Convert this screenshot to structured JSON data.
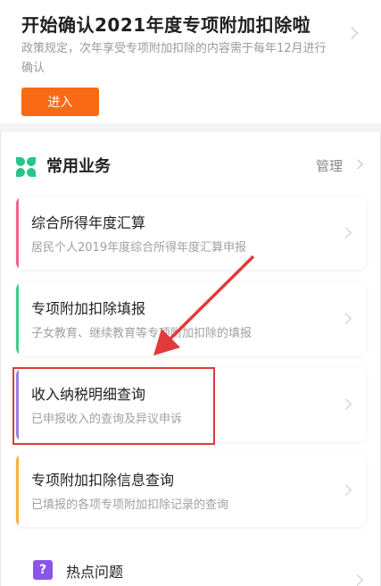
{
  "notice": {
    "title": "开始确认2021年度专项附加扣除啦",
    "description": "政策规定，次年享受专项附加扣除的内容需于每年12月进行确认",
    "enter_label": "进入"
  },
  "section": {
    "title": "常用业务",
    "manage_label": "管理"
  },
  "cards": [
    {
      "title": "综合所得年度汇算",
      "subtitle": "居民个人2019年度综合所得年度汇算申报",
      "accent": "#f2638a"
    },
    {
      "title": "专项附加扣除填报",
      "subtitle": "子女教育、继续教育等专项附加扣除的填报",
      "accent": "#3fcf8e"
    },
    {
      "title": "收入纳税明细查询",
      "subtitle": "已申报收入的查询及异议申诉",
      "accent": "#9b7be8"
    },
    {
      "title": "专项附加扣除信息查询",
      "subtitle": "已填报的各项专项附加扣除记录的查询",
      "accent": "#f7b23b"
    }
  ],
  "hot_topics": {
    "icon_glyph": "?",
    "label": "热点问题"
  },
  "annotation": {
    "color": "#e03a3a"
  }
}
